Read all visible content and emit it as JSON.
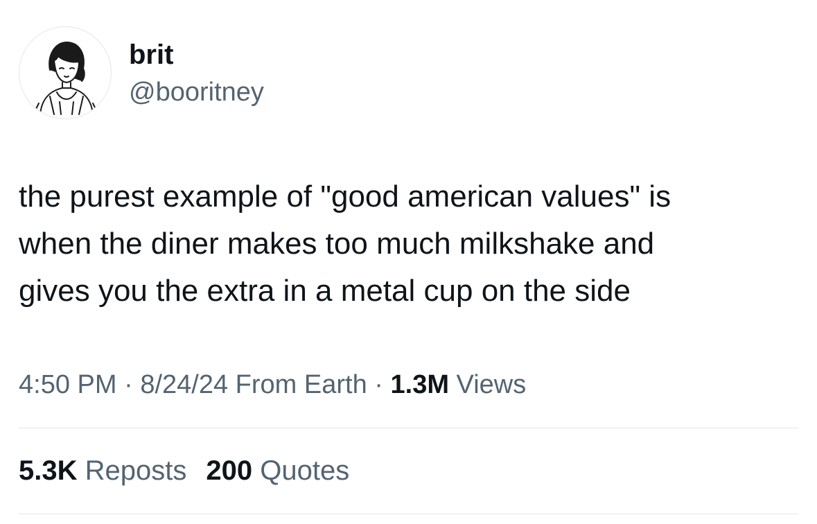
{
  "author": {
    "name": "brit",
    "handle": "@booritney",
    "avatar_icon": "illustrated-portrait-icon"
  },
  "tweet": {
    "lines": [
      "the purest example of \"good american values\" is",
      "when the diner makes too much milkshake and",
      "gives you the extra in a metal cup on the side"
    ]
  },
  "meta": {
    "time": "4:50 PM",
    "separator": "·",
    "date": "8/24/24",
    "source": "From Earth",
    "views_count": "1.3M",
    "views_label": "Views"
  },
  "stats": {
    "reposts_count": "5.3K",
    "reposts_label": "Reposts",
    "quotes_count": "200",
    "quotes_label": "Quotes"
  },
  "colors": {
    "primary_text": "#0f1419",
    "secondary_text": "#536471",
    "divider": "#e1e6ea"
  }
}
